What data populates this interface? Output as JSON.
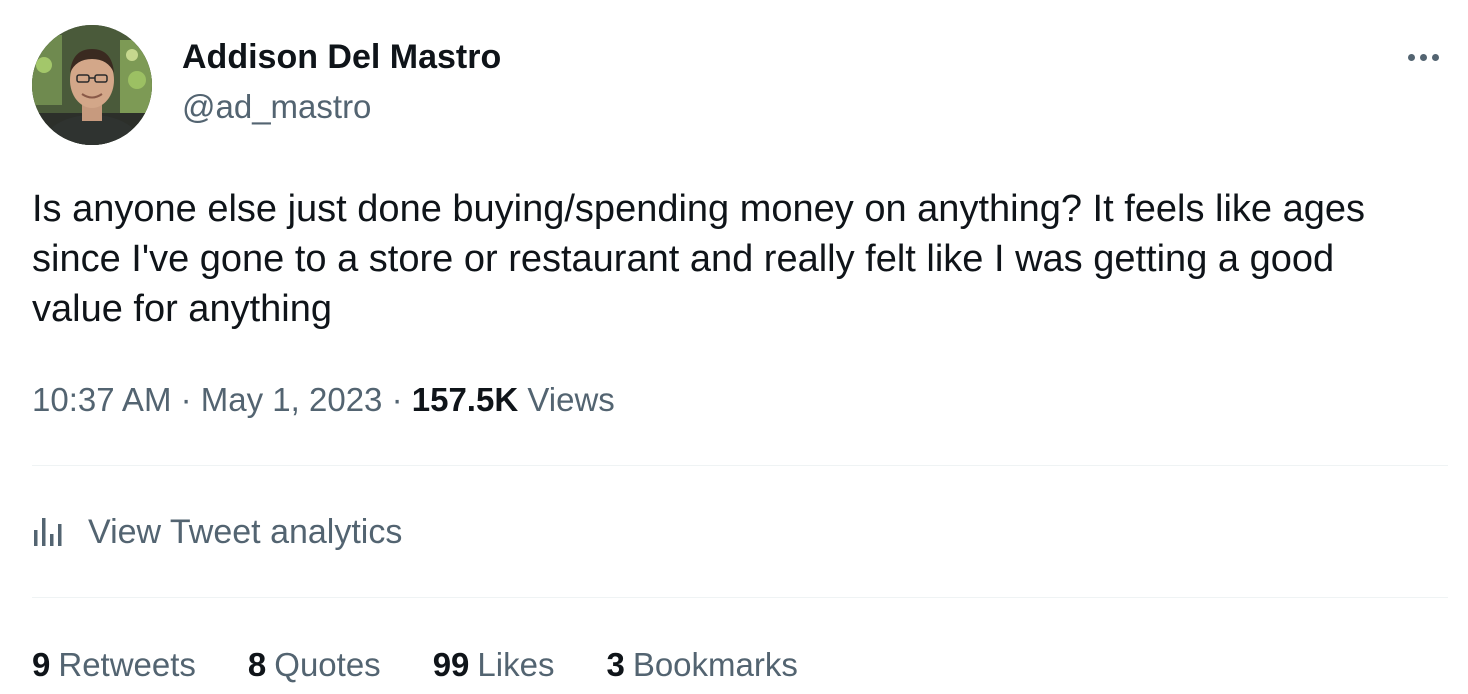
{
  "author": {
    "name": "Addison Del Mastro",
    "handle": "@ad_mastro"
  },
  "tweet": {
    "text": "Is anyone else just done buying/spending money on anything? It feels like ages since I've gone to a store or restaurant and really felt like I was getting a good value for anything",
    "time": "10:37 AM",
    "separator": "·",
    "date": "May 1, 2023",
    "views_count": "157.5K",
    "views_label": "Views"
  },
  "analytics": {
    "label": "View Tweet analytics",
    "icon": "bar-chart-icon"
  },
  "more_icon": "more-horizontal-icon",
  "stats": {
    "retweets": {
      "count": "9",
      "label": "Retweets"
    },
    "quotes": {
      "count": "8",
      "label": "Quotes"
    },
    "likes": {
      "count": "99",
      "label": "Likes"
    },
    "bookmarks": {
      "count": "3",
      "label": "Bookmarks"
    }
  },
  "colors": {
    "text_primary": "#0f1419",
    "text_secondary": "#536471",
    "divider": "#eff3f4"
  }
}
